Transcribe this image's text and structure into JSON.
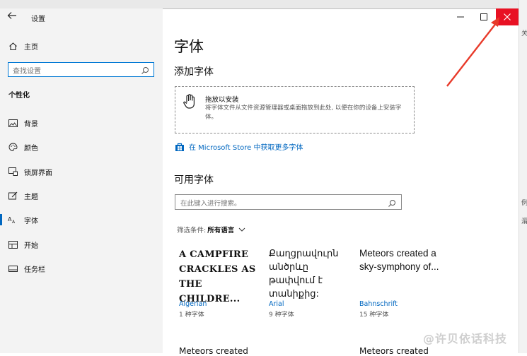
{
  "window": {
    "app_title": "设置",
    "controls": {
      "minimize": "—",
      "maximize": "☐",
      "close": "✕"
    }
  },
  "sidebar": {
    "home": "主页",
    "search_placeholder": "查找设置",
    "section": "个性化",
    "items": [
      {
        "label": "背景",
        "icon": "image-icon"
      },
      {
        "label": "颜色",
        "icon": "palette-icon"
      },
      {
        "label": "锁屏界面",
        "icon": "lock-screen-icon"
      },
      {
        "label": "主题",
        "icon": "theme-icon"
      },
      {
        "label": "字体",
        "icon": "font-icon"
      },
      {
        "label": "开始",
        "icon": "start-icon"
      },
      {
        "label": "任务栏",
        "icon": "taskbar-icon"
      }
    ],
    "active_item": "字体"
  },
  "main": {
    "title": "字体",
    "add_fonts_heading": "添加字体",
    "drop_title": "拖放以安装",
    "drop_desc": "将字体文件从文件资源管理器或桌面拖放到此处, 以便在你的设备上安装字体。",
    "store_link": "在 Microsoft Store 中获取更多字体",
    "available_heading": "可用字体",
    "search_placeholder": "在此键入进行搜索。",
    "filter_label": "筛选条件:",
    "filter_value": "所有语言",
    "fonts": [
      {
        "preview": "A CAMPFIRE CRACKLES AS THE CHILDRE...",
        "name": "Algerian",
        "count": "1 种字体"
      },
      {
        "preview": "Քաղցրավուրն անծրևը թափվում է տանիքից:",
        "name": "Arial",
        "count": "9 种字体"
      },
      {
        "preview": "Meteors created a sky-symphony of...",
        "name": "Bahnschrift",
        "count": "15 种字体"
      }
    ],
    "partial_row": [
      "Meteors created",
      "Meteors created"
    ]
  },
  "background_right": [
    "关",
    "例",
    "漘"
  ],
  "watermark": "@许贝依话科技"
}
